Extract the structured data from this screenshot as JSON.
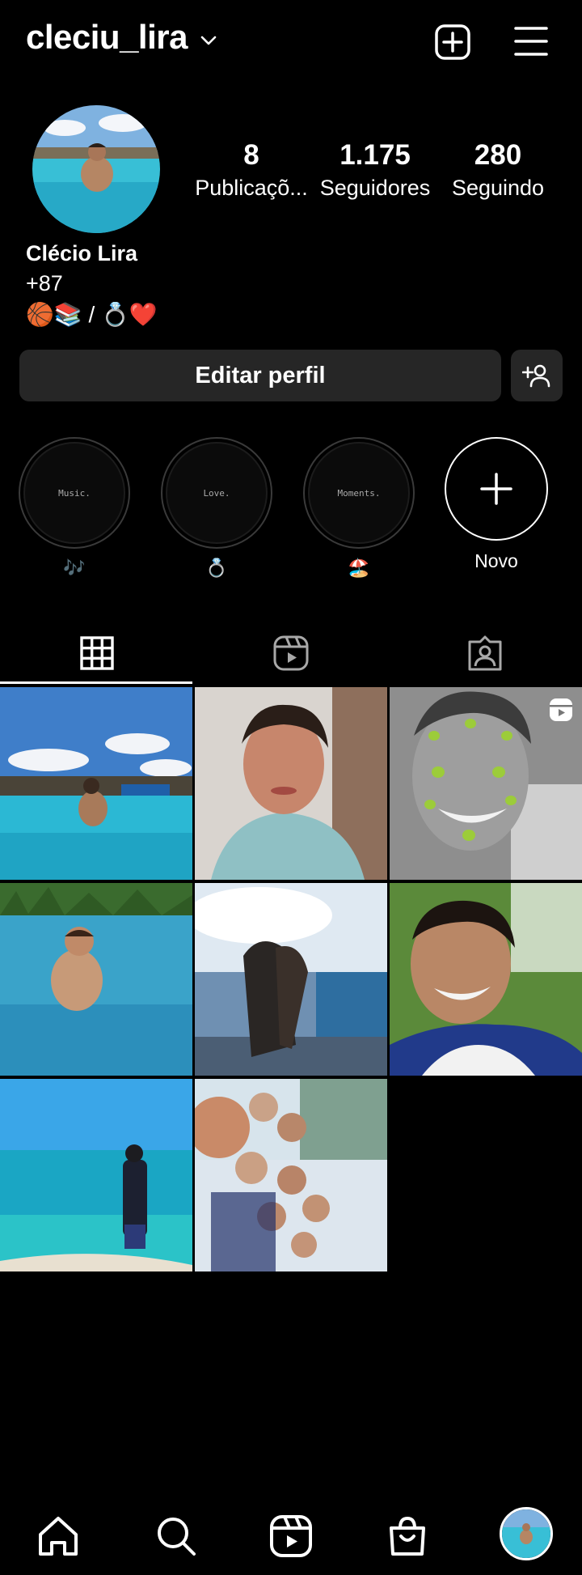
{
  "header": {
    "username": "cleciu_lira"
  },
  "stats": [
    {
      "value": "8",
      "label": "Publicaçõ..."
    },
    {
      "value": "1.175",
      "label": "Seguidores"
    },
    {
      "value": "280",
      "label": "Seguindo"
    }
  ],
  "bio": {
    "full_name": "Clécio Lira",
    "line1": "+87",
    "line2": "🏀📚 / 💍❤️"
  },
  "buttons": {
    "edit_profile": "Editar perfil"
  },
  "highlights": [
    {
      "cover_text": "Music.",
      "caption": "🎶"
    },
    {
      "cover_text": "Love.",
      "caption": "💍"
    },
    {
      "cover_text": "Moments.",
      "caption": "🏖️"
    }
  ],
  "new_highlight_label": "Novo",
  "tabs": [
    {
      "icon": "grid-icon",
      "active": true
    },
    {
      "icon": "reels-icon",
      "active": false
    },
    {
      "icon": "tagged-icon",
      "active": false
    }
  ],
  "grid": [
    {
      "scene": "pool-sky"
    },
    {
      "scene": "selfie-face"
    },
    {
      "scene": "alien-filter",
      "badge": "reels-icon"
    },
    {
      "scene": "pool-beach"
    },
    {
      "scene": "splash-sky"
    },
    {
      "scene": "smile-park"
    },
    {
      "scene": "sea-silhouette"
    },
    {
      "scene": "group-selfie"
    }
  ],
  "nav": [
    "home-icon",
    "search-icon",
    "reels-icon",
    "shop-icon",
    "profile-avatar"
  ],
  "colors": {
    "background": "#000000",
    "button": "#262626",
    "text": "#ffffff"
  }
}
